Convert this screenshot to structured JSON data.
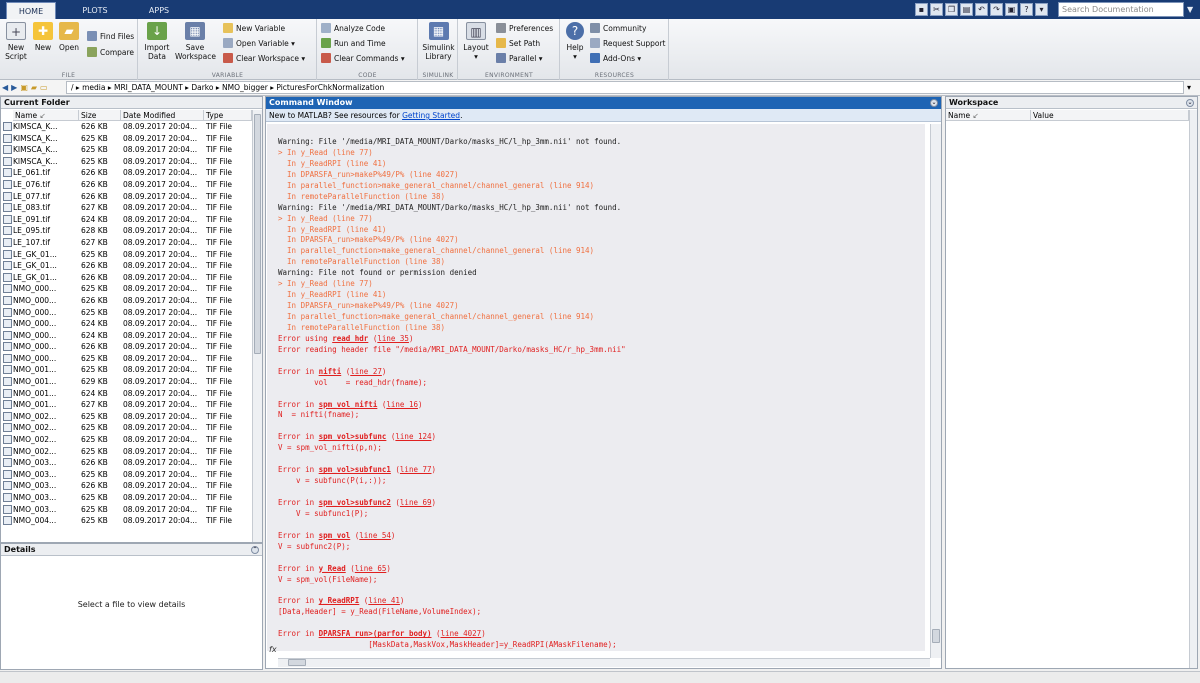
{
  "tabs": [
    "HOME",
    "PLOTS",
    "APPS"
  ],
  "search_placeholder": "Search Documentation",
  "ribbon": {
    "file": {
      "label": "FILE",
      "new_script": "New\nScript",
      "new": "New",
      "open": "Open",
      "find_files": "Find Files",
      "compare": "Compare"
    },
    "variable": {
      "label": "VARIABLE",
      "import_data": "Import\nData",
      "save_workspace": "Save\nWorkspace",
      "new_variable": "New Variable",
      "open_variable": "Open Variable",
      "clear_workspace": "Clear Workspace"
    },
    "code": {
      "label": "CODE",
      "analyze_code": "Analyze Code",
      "run_and_time": "Run and Time",
      "clear_commands": "Clear Commands"
    },
    "simulink": {
      "label": "SIMULINK",
      "simulink_library": "Simulink\nLibrary"
    },
    "environment": {
      "label": "ENVIRONMENT",
      "layout": "Layout",
      "preferences": "Preferences",
      "set_path": "Set Path",
      "parallel": "Parallel"
    },
    "resources": {
      "label": "RESOURCES",
      "help": "Help",
      "community": "Community",
      "request_support": "Request Support",
      "add_ons": "Add-Ons"
    }
  },
  "address_path": [
    "/",
    "media",
    "MRI_DATA_MOUNT",
    "Darko",
    "NMO_bigger",
    "PicturesForChkNormalization"
  ],
  "current_folder": {
    "title": "Current Folder",
    "columns": [
      "Name",
      "Size",
      "Date Modified",
      "Type"
    ],
    "files": [
      {
        "name": "KIMSCA_K...",
        "size": "626 KB",
        "date": "08.09.2017 20:04...",
        "type": "TIF File"
      },
      {
        "name": "KIMSCA_K...",
        "size": "625 KB",
        "date": "08.09.2017 20:04...",
        "type": "TIF File"
      },
      {
        "name": "KIMSCA_K...",
        "size": "625 KB",
        "date": "08.09.2017 20:04...",
        "type": "TIF File"
      },
      {
        "name": "KIMSCA_K...",
        "size": "625 KB",
        "date": "08.09.2017 20:04...",
        "type": "TIF File"
      },
      {
        "name": "LE_061.tif",
        "size": "626 KB",
        "date": "08.09.2017 20:04...",
        "type": "TIF File"
      },
      {
        "name": "LE_076.tif",
        "size": "626 KB",
        "date": "08.09.2017 20:04...",
        "type": "TIF File"
      },
      {
        "name": "LE_077.tif",
        "size": "626 KB",
        "date": "08.09.2017 20:04...",
        "type": "TIF File"
      },
      {
        "name": "LE_083.tif",
        "size": "627 KB",
        "date": "08.09.2017 20:04...",
        "type": "TIF File"
      },
      {
        "name": "LE_091.tif",
        "size": "624 KB",
        "date": "08.09.2017 20:04...",
        "type": "TIF File"
      },
      {
        "name": "LE_095.tif",
        "size": "628 KB",
        "date": "08.09.2017 20:04...",
        "type": "TIF File"
      },
      {
        "name": "LE_107.tif",
        "size": "627 KB",
        "date": "08.09.2017 20:04...",
        "type": "TIF File"
      },
      {
        "name": "LE_GK_01...",
        "size": "625 KB",
        "date": "08.09.2017 20:04...",
        "type": "TIF File"
      },
      {
        "name": "LE_GK_01...",
        "size": "626 KB",
        "date": "08.09.2017 20:04...",
        "type": "TIF File"
      },
      {
        "name": "LE_GK_01...",
        "size": "626 KB",
        "date": "08.09.2017 20:04...",
        "type": "TIF File"
      },
      {
        "name": "NMO_000...",
        "size": "625 KB",
        "date": "08.09.2017 20:04...",
        "type": "TIF File"
      },
      {
        "name": "NMO_000...",
        "size": "626 KB",
        "date": "08.09.2017 20:04...",
        "type": "TIF File"
      },
      {
        "name": "NMO_000...",
        "size": "625 KB",
        "date": "08.09.2017 20:04...",
        "type": "TIF File"
      },
      {
        "name": "NMO_000...",
        "size": "624 KB",
        "date": "08.09.2017 20:04...",
        "type": "TIF File"
      },
      {
        "name": "NMO_000...",
        "size": "624 KB",
        "date": "08.09.2017 20:04...",
        "type": "TIF File"
      },
      {
        "name": "NMO_000...",
        "size": "626 KB",
        "date": "08.09.2017 20:04...",
        "type": "TIF File"
      },
      {
        "name": "NMO_000...",
        "size": "625 KB",
        "date": "08.09.2017 20:04...",
        "type": "TIF File"
      },
      {
        "name": "NMO_001...",
        "size": "625 KB",
        "date": "08.09.2017 20:04...",
        "type": "TIF File"
      },
      {
        "name": "NMO_001...",
        "size": "629 KB",
        "date": "08.09.2017 20:04...",
        "type": "TIF File"
      },
      {
        "name": "NMO_001...",
        "size": "624 KB",
        "date": "08.09.2017 20:04...",
        "type": "TIF File"
      },
      {
        "name": "NMO_001...",
        "size": "627 KB",
        "date": "08.09.2017 20:04...",
        "type": "TIF File"
      },
      {
        "name": "NMO_002...",
        "size": "625 KB",
        "date": "08.09.2017 20:04...",
        "type": "TIF File"
      },
      {
        "name": "NMO_002...",
        "size": "625 KB",
        "date": "08.09.2017 20:04...",
        "type": "TIF File"
      },
      {
        "name": "NMO_002...",
        "size": "625 KB",
        "date": "08.09.2017 20:04...",
        "type": "TIF File"
      },
      {
        "name": "NMO_002...",
        "size": "625 KB",
        "date": "08.09.2017 20:04...",
        "type": "TIF File"
      },
      {
        "name": "NMO_003...",
        "size": "626 KB",
        "date": "08.09.2017 20:04...",
        "type": "TIF File"
      },
      {
        "name": "NMO_003...",
        "size": "625 KB",
        "date": "08.09.2017 20:04...",
        "type": "TIF File"
      },
      {
        "name": "NMO_003...",
        "size": "626 KB",
        "date": "08.09.2017 20:04...",
        "type": "TIF File"
      },
      {
        "name": "NMO_003...",
        "size": "625 KB",
        "date": "08.09.2017 20:04...",
        "type": "TIF File"
      },
      {
        "name": "NMO_003...",
        "size": "625 KB",
        "date": "08.09.2017 20:04...",
        "type": "TIF File"
      },
      {
        "name": "NMO_004...",
        "size": "625 KB",
        "date": "08.09.2017 20:04...",
        "type": "TIF File"
      }
    ]
  },
  "details": {
    "title": "Details",
    "empty_text": "Select a file to view details"
  },
  "command_window": {
    "title": "Command Window",
    "info_prefix": "New to MATLAB? See resources for ",
    "info_link": "Getting Started",
    "info_suffix": ".",
    "lines": [
      {
        "t": "Warning: File '/media/MRI_DATA_MOUNT/Darko/masks_HC/l_hp_3mm.nii' not found.",
        "c": "warn"
      },
      {
        "t": "> In y_Read (line 77)",
        "c": "stk"
      },
      {
        "t": "  In y_ReadRPI (line 41)",
        "c": "stk"
      },
      {
        "t": "  In DPARSFA_run>makeP%49/P% (line 4027)",
        "c": "stk"
      },
      {
        "t": "  In parallel_function>make_general_channel/channel_general (line 914)",
        "c": "stk"
      },
      {
        "t": "  In remoteParallelFunction (line 38)",
        "c": "stk"
      },
      {
        "t": "Warning: File '/media/MRI_DATA_MOUNT/Darko/masks_HC/l_hp_3mm.nii' not found.",
        "c": "warn"
      },
      {
        "t": "> In y_Read (line 77)",
        "c": "stk"
      },
      {
        "t": "  In y_ReadRPI (line 41)",
        "c": "stk"
      },
      {
        "t": "  In DPARSFA_run>makeP%49/P% (line 4027)",
        "c": "stk"
      },
      {
        "t": "  In parallel_function>make_general_channel/channel_general (line 914)",
        "c": "stk"
      },
      {
        "t": "  In remoteParallelFunction (line 38)",
        "c": "stk"
      },
      {
        "t": "Warning: File not found or permission denied",
        "c": "warn"
      },
      {
        "t": "> In y_Read (line 77)",
        "c": "stk"
      },
      {
        "t": "  In y_ReadRPI (line 41)",
        "c": "stk"
      },
      {
        "t": "  In DPARSFA_run>makeP%49/P% (line 4027)",
        "c": "stk"
      },
      {
        "t": "  In parallel_function>make_general_channel/channel_general (line 914)",
        "c": "stk"
      },
      {
        "t": "  In remoteParallelFunction (line 38)",
        "c": "stk"
      },
      {
        "c": "err",
        "parts": [
          {
            "t": "Error using "
          },
          {
            "t": "read_hdr",
            "l": "b"
          },
          {
            "t": " ("
          },
          {
            "t": "line 35",
            "l": "u"
          },
          {
            "t": ")"
          }
        ]
      },
      {
        "t": "Error reading header file \"/media/MRI_DATA_MOUNT/Darko/masks_HC/r_hp_3mm.nii\"",
        "c": "err"
      },
      {
        "t": "",
        "c": "err"
      },
      {
        "c": "err",
        "parts": [
          {
            "t": "Error in "
          },
          {
            "t": "nifti",
            "l": "b"
          },
          {
            "t": " ("
          },
          {
            "t": "line 27",
            "l": "u"
          },
          {
            "t": ")"
          }
        ]
      },
      {
        "t": "        vol    = read_hdr(fname);",
        "c": "err"
      },
      {
        "t": "",
        "c": "err"
      },
      {
        "c": "err",
        "parts": [
          {
            "t": "Error in "
          },
          {
            "t": "spm_vol_nifti",
            "l": "b"
          },
          {
            "t": " ("
          },
          {
            "t": "line 16",
            "l": "u"
          },
          {
            "t": ")"
          }
        ]
      },
      {
        "t": "N  = nifti(fname);",
        "c": "err"
      },
      {
        "t": "",
        "c": "err"
      },
      {
        "c": "err",
        "parts": [
          {
            "t": "Error in "
          },
          {
            "t": "spm_vol>subfunc",
            "l": "b"
          },
          {
            "t": " ("
          },
          {
            "t": "line 124",
            "l": "u"
          },
          {
            "t": ")"
          }
        ]
      },
      {
        "t": "V = spm_vol_nifti(p,n);",
        "c": "err"
      },
      {
        "t": "",
        "c": "err"
      },
      {
        "c": "err",
        "parts": [
          {
            "t": "Error in "
          },
          {
            "t": "spm_vol>subfunc1",
            "l": "b"
          },
          {
            "t": " ("
          },
          {
            "t": "line 77",
            "l": "u"
          },
          {
            "t": ")"
          }
        ]
      },
      {
        "t": "    v = subfunc(P(i,:));",
        "c": "err"
      },
      {
        "t": "",
        "c": "err"
      },
      {
        "c": "err",
        "parts": [
          {
            "t": "Error in "
          },
          {
            "t": "spm_vol>subfunc2",
            "l": "b"
          },
          {
            "t": " ("
          },
          {
            "t": "line 69",
            "l": "u"
          },
          {
            "t": ")"
          }
        ]
      },
      {
        "t": "    V = subfunc1(P);",
        "c": "err"
      },
      {
        "t": "",
        "c": "err"
      },
      {
        "c": "err",
        "parts": [
          {
            "t": "Error in "
          },
          {
            "t": "spm_vol",
            "l": "b"
          },
          {
            "t": " ("
          },
          {
            "t": "line 54",
            "l": "u"
          },
          {
            "t": ")"
          }
        ]
      },
      {
        "t": "V = subfunc2(P);",
        "c": "err"
      },
      {
        "t": "",
        "c": "err"
      },
      {
        "c": "err",
        "parts": [
          {
            "t": "Error in "
          },
          {
            "t": "y_Read",
            "l": "b"
          },
          {
            "t": " ("
          },
          {
            "t": "line 65",
            "l": "u"
          },
          {
            "t": ")"
          }
        ]
      },
      {
        "t": "V = spm_vol(FileName);",
        "c": "err"
      },
      {
        "t": "",
        "c": "err"
      },
      {
        "c": "err",
        "parts": [
          {
            "t": "Error in "
          },
          {
            "t": "y_ReadRPI",
            "l": "b"
          },
          {
            "t": " ("
          },
          {
            "t": "line 41",
            "l": "u"
          },
          {
            "t": ")"
          }
        ]
      },
      {
        "t": "[Data,Header] = y_Read(FileName,VolumeIndex);",
        "c": "err"
      },
      {
        "t": "",
        "c": "err"
      },
      {
        "c": "err",
        "parts": [
          {
            "t": "Error in "
          },
          {
            "t": "DPARSFA_run>(parfor body)",
            "l": "b"
          },
          {
            "t": " ("
          },
          {
            "t": "line 4027",
            "l": "u"
          },
          {
            "t": ")"
          }
        ]
      },
      {
        "t": "                    [MaskData,MaskVox,MaskHeader]=y_ReadRPI(AMaskFilename);",
        "c": "err"
      }
    ],
    "prompt_icon": "fx"
  },
  "workspace": {
    "title": "Workspace",
    "columns": [
      "Name",
      "Value"
    ]
  }
}
